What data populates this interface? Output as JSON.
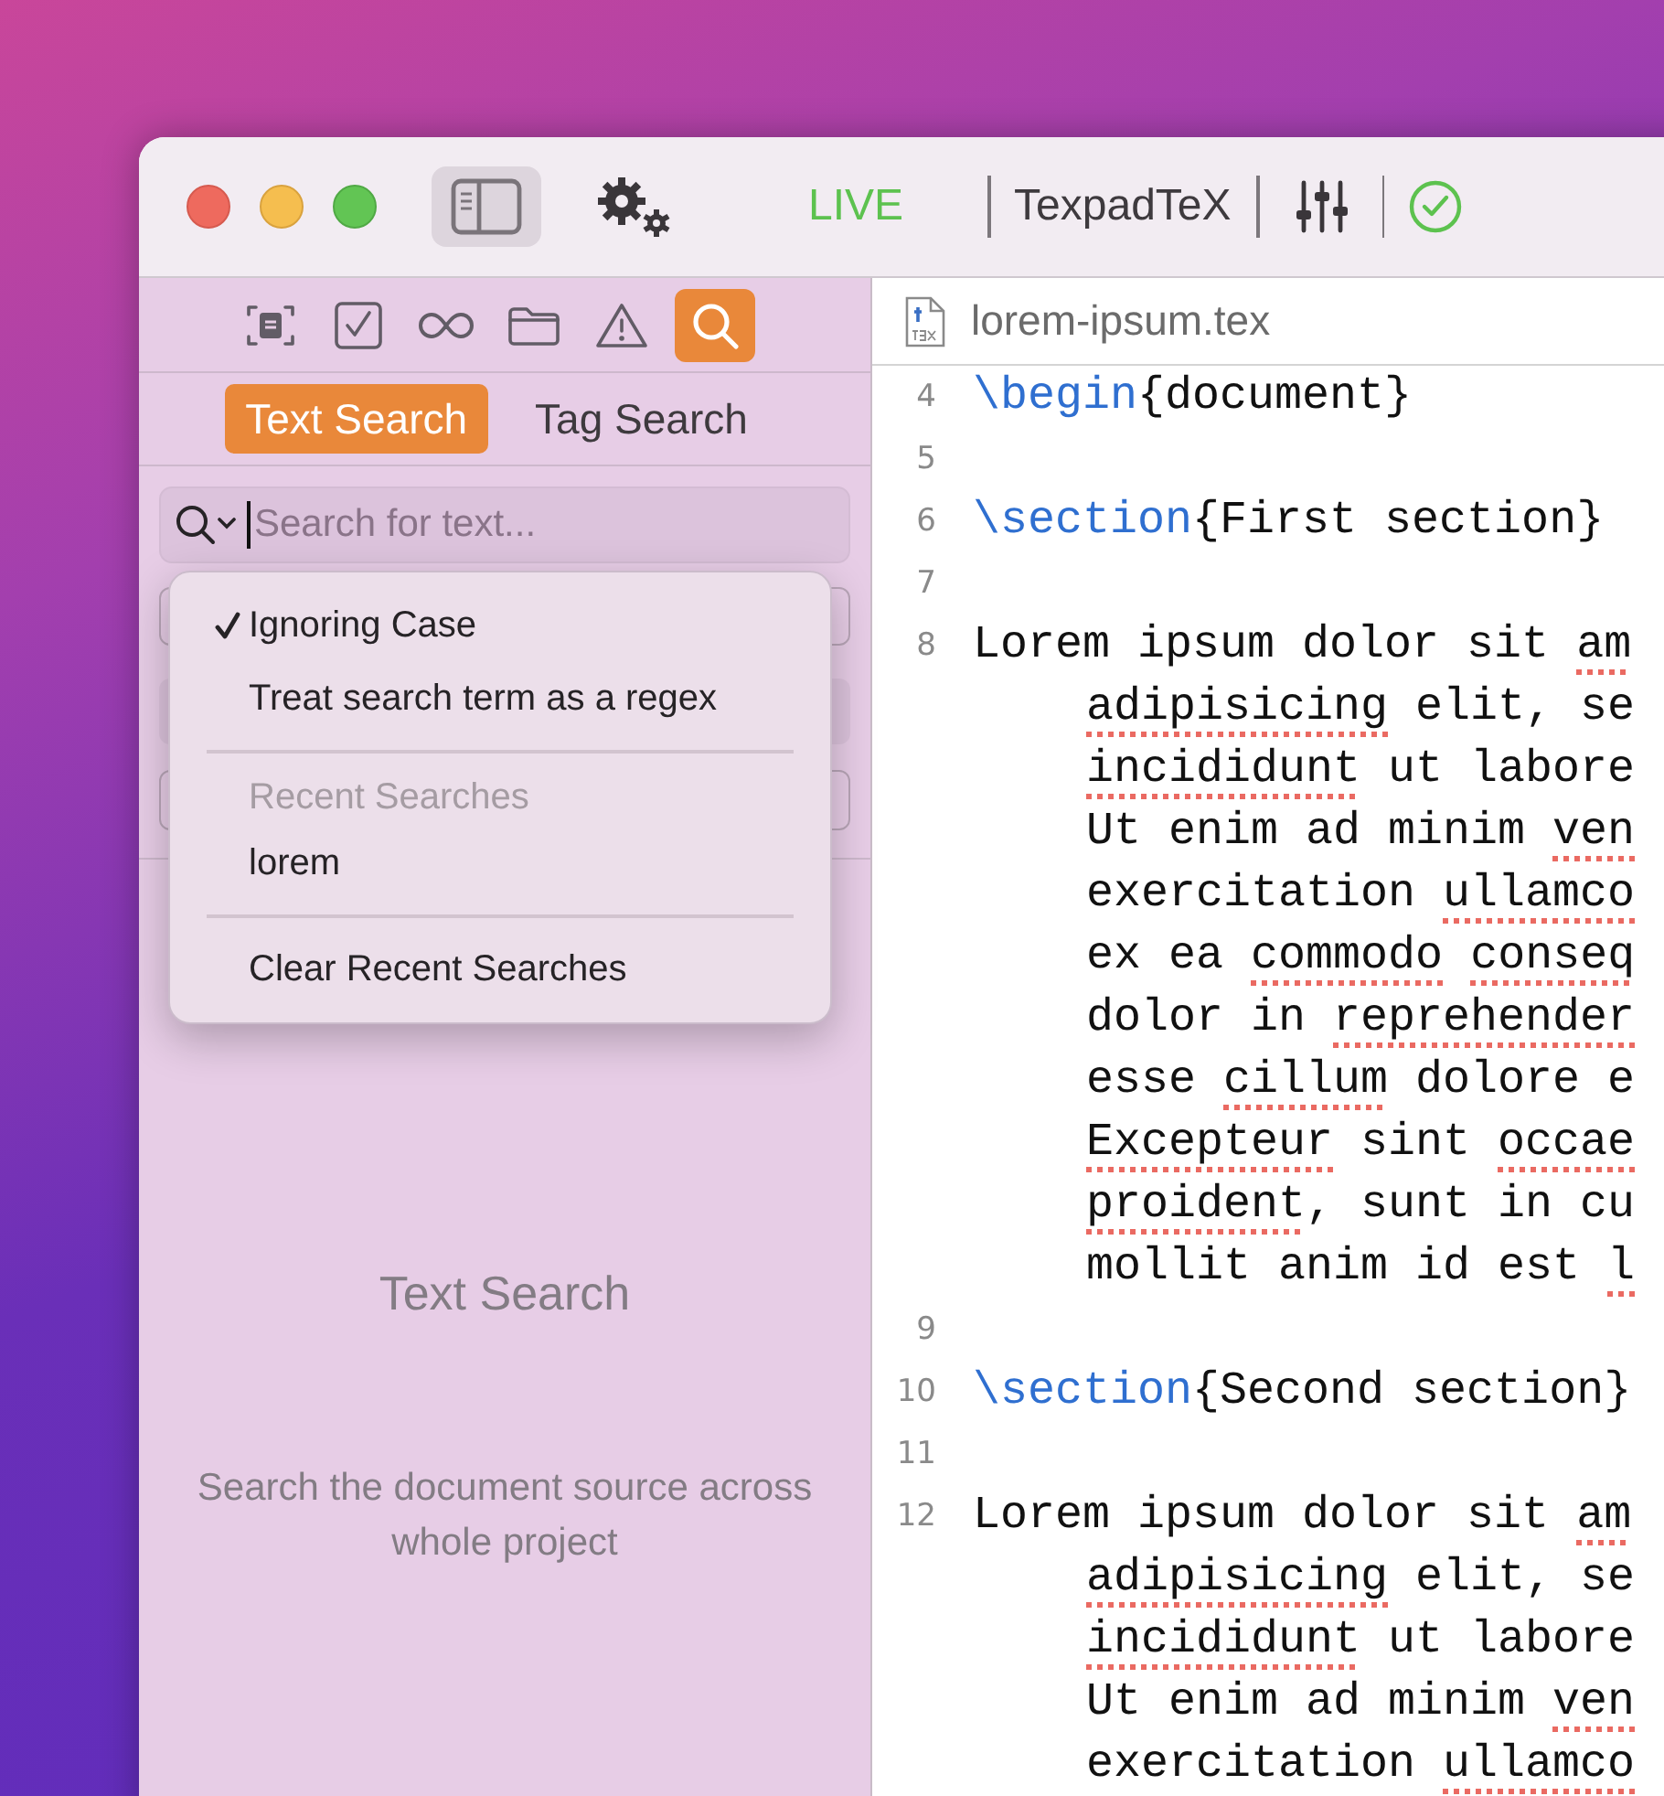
{
  "toolbar": {
    "live": "LIVE",
    "engine": "TexpadTeX"
  },
  "sidebar": {
    "icon_tabs": [
      {
        "kind": "outline",
        "selected": false
      },
      {
        "kind": "todo",
        "selected": false
      },
      {
        "kind": "links",
        "selected": false
      },
      {
        "kind": "files",
        "selected": false
      },
      {
        "kind": "issues",
        "selected": false
      },
      {
        "kind": "search",
        "selected": true
      }
    ],
    "segments": [
      {
        "label": "Text Search",
        "selected": true
      },
      {
        "label": "Tag Search",
        "selected": false
      }
    ],
    "search": {
      "placeholder": "Search for text..."
    },
    "menu": [
      {
        "kind": "option",
        "label": "Ignoring Case",
        "checked": true
      },
      {
        "kind": "option",
        "label": "Treat search term as a regex",
        "checked": false
      },
      {
        "kind": "separator"
      },
      {
        "kind": "header",
        "label": "Recent Searches"
      },
      {
        "kind": "recent",
        "label": "lorem"
      },
      {
        "kind": "separator"
      },
      {
        "kind": "action",
        "label": "Clear Recent Searches"
      }
    ],
    "empty_state": {
      "title": "Text Search",
      "description": "Search the document source across whole project"
    }
  },
  "editor": {
    "filename": "lorem-ipsum.tex",
    "lines": [
      {
        "number": "4",
        "rows": [
          [
            {
              "kind": "command",
              "text": "\\begin"
            },
            {
              "kind": "text",
              "text": "{document}"
            }
          ]
        ]
      },
      {
        "number": "5"
      },
      {
        "number": "6",
        "rows": [
          [
            {
              "kind": "command",
              "text": "\\section"
            },
            {
              "kind": "text",
              "text": "{First section}"
            }
          ]
        ]
      },
      {
        "number": "7"
      },
      {
        "number": "8",
        "rows": [
          [
            {
              "kind": "text",
              "text": "Lorem ipsum dolor sit "
            },
            {
              "kind": "misspelled",
              "text": "am"
            }
          ],
          [
            {
              "kind": "misspelled",
              "text": "adipisicing"
            },
            {
              "kind": "text",
              "text": " elit, se"
            }
          ],
          [
            {
              "kind": "misspelled",
              "text": "incididunt"
            },
            {
              "kind": "text",
              "text": " ut labore"
            }
          ],
          [
            {
              "kind": "text",
              "text": "Ut enim ad minim "
            },
            {
              "kind": "misspelled",
              "text": "ven"
            }
          ],
          [
            {
              "kind": "text",
              "text": "exercitation "
            },
            {
              "kind": "misspelled",
              "text": "ullamco"
            }
          ],
          [
            {
              "kind": "text",
              "text": "ex ea "
            },
            {
              "kind": "misspelled",
              "text": "commodo"
            },
            {
              "kind": "text",
              "text": " "
            },
            {
              "kind": "misspelled",
              "text": "conseq"
            }
          ],
          [
            {
              "kind": "text",
              "text": "dolor in "
            },
            {
              "kind": "misspelled",
              "text": "reprehender"
            }
          ],
          [
            {
              "kind": "text",
              "text": "esse "
            },
            {
              "kind": "misspelled",
              "text": "cillum"
            },
            {
              "kind": "text",
              "text": " dolore e"
            }
          ],
          [
            {
              "kind": "misspelled",
              "text": "Excepteur"
            },
            {
              "kind": "text",
              "text": " sint "
            },
            {
              "kind": "misspelled",
              "text": "occae"
            }
          ],
          [
            {
              "kind": "misspelled",
              "text": "proident"
            },
            {
              "kind": "text",
              "text": ", sunt in cu"
            }
          ],
          [
            {
              "kind": "text",
              "text": "mollit anim id est "
            },
            {
              "kind": "misspelled",
              "text": "l"
            }
          ]
        ]
      },
      {
        "number": "9"
      },
      {
        "number": "10",
        "rows": [
          [
            {
              "kind": "command",
              "text": "\\section"
            },
            {
              "kind": "text",
              "text": "{Second section}"
            }
          ]
        ]
      },
      {
        "number": "11"
      },
      {
        "number": "12",
        "rows": [
          [
            {
              "kind": "text",
              "text": "Lorem ipsum dolor sit "
            },
            {
              "kind": "misspelled",
              "text": "am"
            }
          ],
          [
            {
              "kind": "misspelled",
              "text": "adipisicing"
            },
            {
              "kind": "text",
              "text": " elit, se"
            }
          ],
          [
            {
              "kind": "misspelled",
              "text": "incididunt"
            },
            {
              "kind": "text",
              "text": " ut labore"
            }
          ],
          [
            {
              "kind": "text",
              "text": "Ut enim ad minim "
            },
            {
              "kind": "misspelled",
              "text": "ven"
            }
          ],
          [
            {
              "kind": "text",
              "text": "exercitation "
            },
            {
              "kind": "misspelled",
              "text": "ullamco"
            }
          ]
        ]
      }
    ]
  }
}
